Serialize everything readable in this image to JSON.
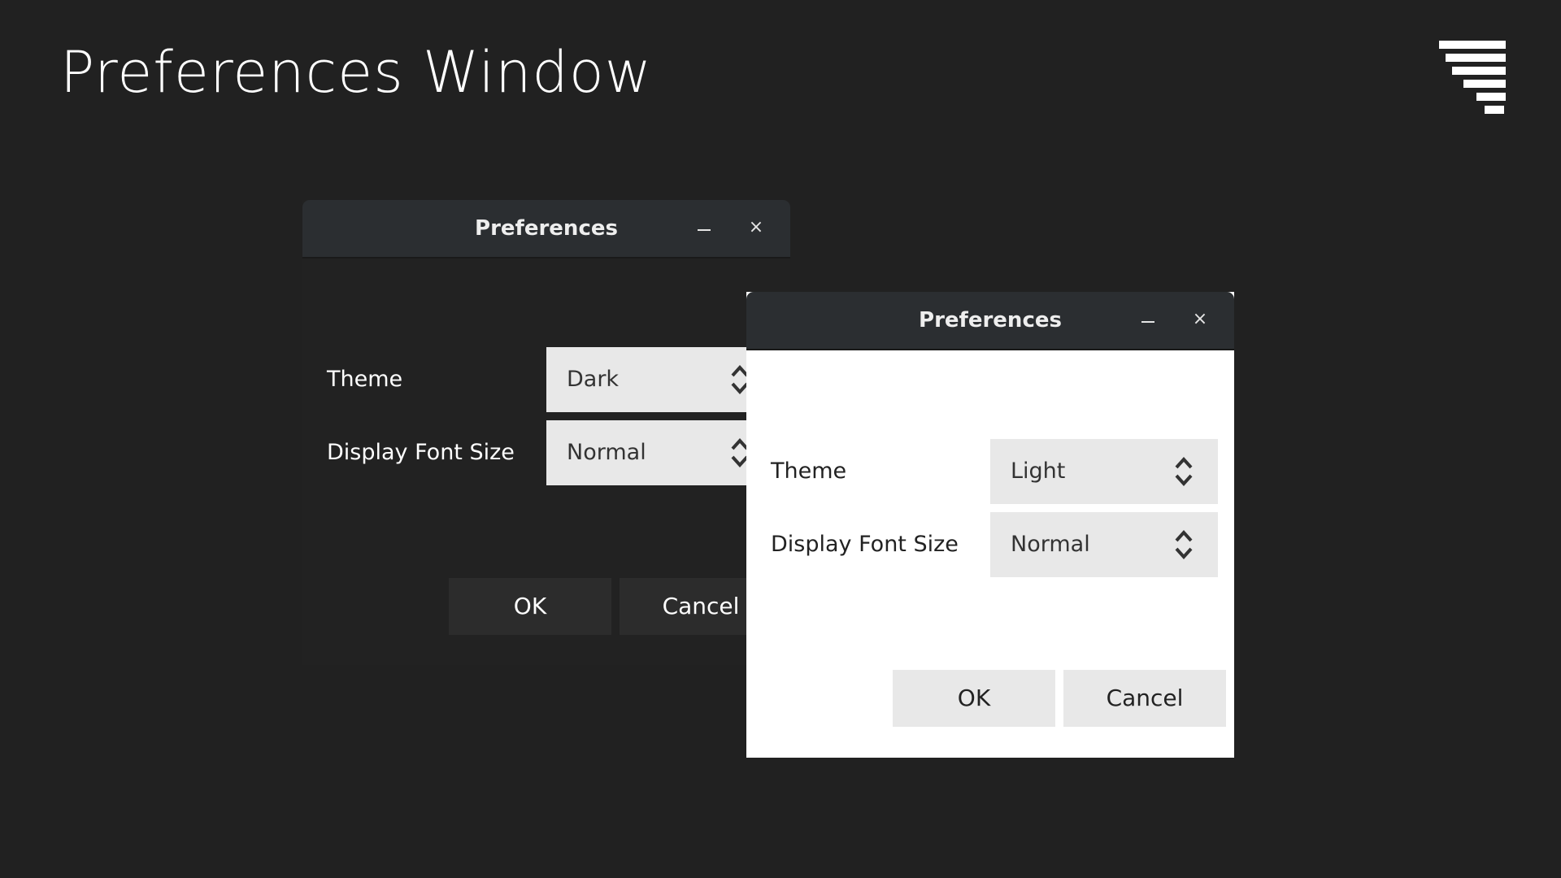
{
  "slide": {
    "title": "Preferences Window"
  },
  "brand": {
    "logo_icon": "striped-funnel-logo",
    "color": "#ffffff"
  },
  "windows": [
    {
      "variant": "dark",
      "title": "Preferences",
      "minimize_icon": "minimize-icon",
      "close_icon": "close-icon",
      "close_glyph": "×",
      "theme_label": "Theme",
      "theme_value": "Dark",
      "font_size_label": "Display Font Size",
      "font_size_value": "Normal",
      "ok_label": "OK",
      "cancel_label": "Cancel"
    },
    {
      "variant": "light",
      "title": "Preferences",
      "minimize_icon": "minimize-icon",
      "close_icon": "close-icon",
      "close_glyph": "×",
      "theme_label": "Theme",
      "theme_value": "Light",
      "font_size_label": "Display Font Size",
      "font_size_value": "Normal",
      "ok_label": "OK",
      "cancel_label": "Cancel"
    }
  ],
  "colors": {
    "background": "#212121",
    "titlebar": "#2b2e31",
    "dark_window_body": "#222222",
    "light_window_body": "#ffffff",
    "control": "#e8e8e8"
  }
}
